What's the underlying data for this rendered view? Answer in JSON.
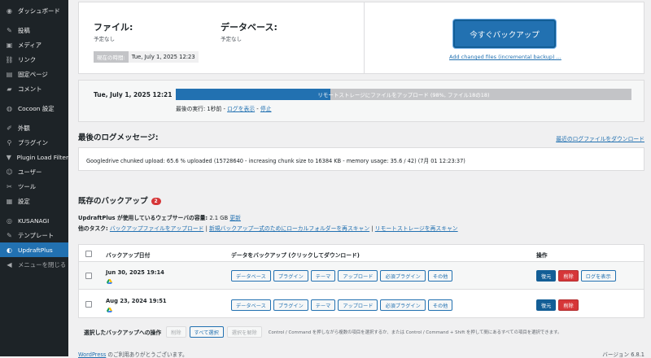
{
  "sidebar": {
    "items": [
      {
        "icon": "dashboard-icon",
        "glyph": "◉",
        "label": "ダッシュボード"
      },
      {
        "icon": "pin-icon",
        "glyph": "✎",
        "label": "投稿"
      },
      {
        "icon": "media-icon",
        "glyph": "▣",
        "label": "メディア"
      },
      {
        "icon": "link-icon",
        "glyph": "⛓",
        "label": "リンク"
      },
      {
        "icon": "page-icon",
        "glyph": "▤",
        "label": "固定ページ"
      },
      {
        "icon": "comment-icon",
        "glyph": "▰",
        "label": "コメント"
      },
      {
        "icon": "cocoon-icon",
        "glyph": "◍",
        "label": "Cocoon 設定"
      },
      {
        "icon": "appearance-icon",
        "glyph": "✐",
        "label": "外観"
      },
      {
        "icon": "plugin-icon",
        "glyph": "⚲",
        "label": "プラグイン"
      },
      {
        "icon": "filter-icon",
        "glyph": "▼",
        "label": "Plugin Load Filter"
      },
      {
        "icon": "users-icon",
        "glyph": "☺",
        "label": "ユーザー"
      },
      {
        "icon": "tools-icon",
        "glyph": "✂",
        "label": "ツール"
      },
      {
        "icon": "settings-icon",
        "glyph": "▦",
        "label": "設定"
      },
      {
        "icon": "kusanagi-icon",
        "glyph": "◎",
        "label": "KUSANAGI"
      },
      {
        "icon": "template-icon",
        "glyph": "✎",
        "label": "テンプレート"
      },
      {
        "icon": "updraft-icon",
        "glyph": "◐",
        "label": "UpdraftPlus"
      },
      {
        "icon": "collapse-icon",
        "glyph": "◀",
        "label": "メニューを閉じる"
      }
    ]
  },
  "status": {
    "files_label": "ファイル:",
    "files_value": "予定なし",
    "db_label": "データベース:",
    "db_value": "予定なし",
    "now_label": "現在の時間:",
    "now_value": "Tue, July 1, 2025 12:23",
    "backup_now": "今すぐバックアップ",
    "add_incremental": "Add changed files (incremental backup) ..."
  },
  "progress": {
    "date": "Tue, July 1, 2025 12:21",
    "text": "リモートストレージにファイルをアップロード (98%, ファイル18の18)",
    "percent": 98,
    "fill_percent": 34,
    "last_run_prefix": "最後の実行: 1秒前 - ",
    "view_log": "ログを表示",
    "sep": " - ",
    "stop": "停止"
  },
  "log": {
    "heading": "最後のログメッセージ:",
    "download_link": "最近のログファイルをダウンロード",
    "message": "Googledrive chunked upload: 65.6 % uploaded (15728640 - increasing chunk size to 16384 KB - memory usage: 35.6 / 42) (7月 01 12:23:37)"
  },
  "existing": {
    "heading": "既存のバックアップ",
    "count": "2",
    "usage_prefix": "UpdraftPlus が使用しているウェブサーバの容量:",
    "usage_value": " 2.1 GB ",
    "usage_refresh": "更新",
    "tasks_label": "他のタスク:",
    "task1": "バックアップファイルをアップロード",
    "task_sep": " | ",
    "task2": "新規バックアップ一式のためにローカルフォルダーを再スキャン",
    "task3": "リモートストレージを再スキャン"
  },
  "table": {
    "col_date": "バックアップ日付",
    "col_data": "データをバックアップ (クリックしてダウンロード)",
    "col_actions": "操作",
    "rows": [
      {
        "date": "Jun 30, 2025 19:14",
        "components": [
          "データベース",
          "プラグイン",
          "テーマ",
          "アップロード",
          "必須プラグイン",
          "その他"
        ],
        "restore": "復元",
        "delete": "削除",
        "view_log": "ログを表示"
      },
      {
        "date": "Aug 23, 2024 19:51",
        "components": [
          "データベース",
          "プラグイン",
          "テーマ",
          "アップロード",
          "必須プラグイン",
          "その他"
        ],
        "restore": "復元",
        "delete": "削除"
      }
    ]
  },
  "bulk": {
    "label": "選択したバックアップへの操作",
    "delete": "削除",
    "select_all": "すべて選択",
    "deselect": "選択を解除",
    "hint": "Control / Command を押しながら複数の項目を選択するか、または Control / Command + Shift を押して間にあるすべての項目を選択できます。"
  },
  "footer": {
    "wp_link": "WordPress",
    "thanks": " のご利用ありがとうございます。",
    "version": "バージョン 6.8.1"
  },
  "colors": {
    "accent": "#2271b1",
    "danger": "#d63638",
    "sidebar": "#1d2327"
  }
}
